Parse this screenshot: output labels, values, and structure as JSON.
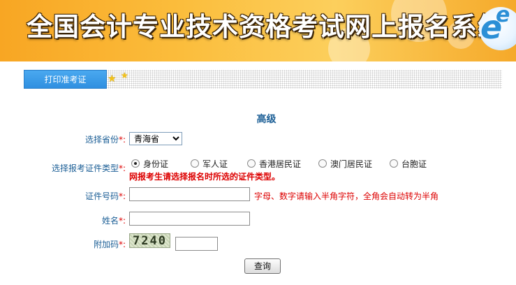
{
  "header": {
    "title": "全国会计专业技术资格考试网上报名系统",
    "logo_letters": "ee"
  },
  "tabs": [
    {
      "label": "打印准考证"
    }
  ],
  "form": {
    "heading": "高级",
    "province": {
      "label": "选择省份",
      "required_mark": "*:",
      "selected": "青海省",
      "options": [
        "青海省"
      ]
    },
    "id_type": {
      "label": "选择报考证件类型",
      "required_mark": "*:",
      "options": [
        "身份证",
        "军人证",
        "香港居民证",
        "澳门居民证",
        "台胞证"
      ],
      "selected": "身份证",
      "warning": "网报考生请选择报名时所选的证件类型。"
    },
    "id_number": {
      "label": "证件号码",
      "required_mark": "*:",
      "value": "",
      "hint": "字母、数字请输入半角字符，全角会自动转为半角"
    },
    "name": {
      "label": "姓名",
      "required_mark": "*:",
      "value": ""
    },
    "captcha": {
      "label": "附加码",
      "required_mark": "*:",
      "image_text": "7240",
      "value": ""
    },
    "submit_label": "查询"
  },
  "colors": {
    "label": "#1c5f96",
    "warning": "#dd0000",
    "tab": "#3a9be6",
    "banner": "#f8a623"
  }
}
